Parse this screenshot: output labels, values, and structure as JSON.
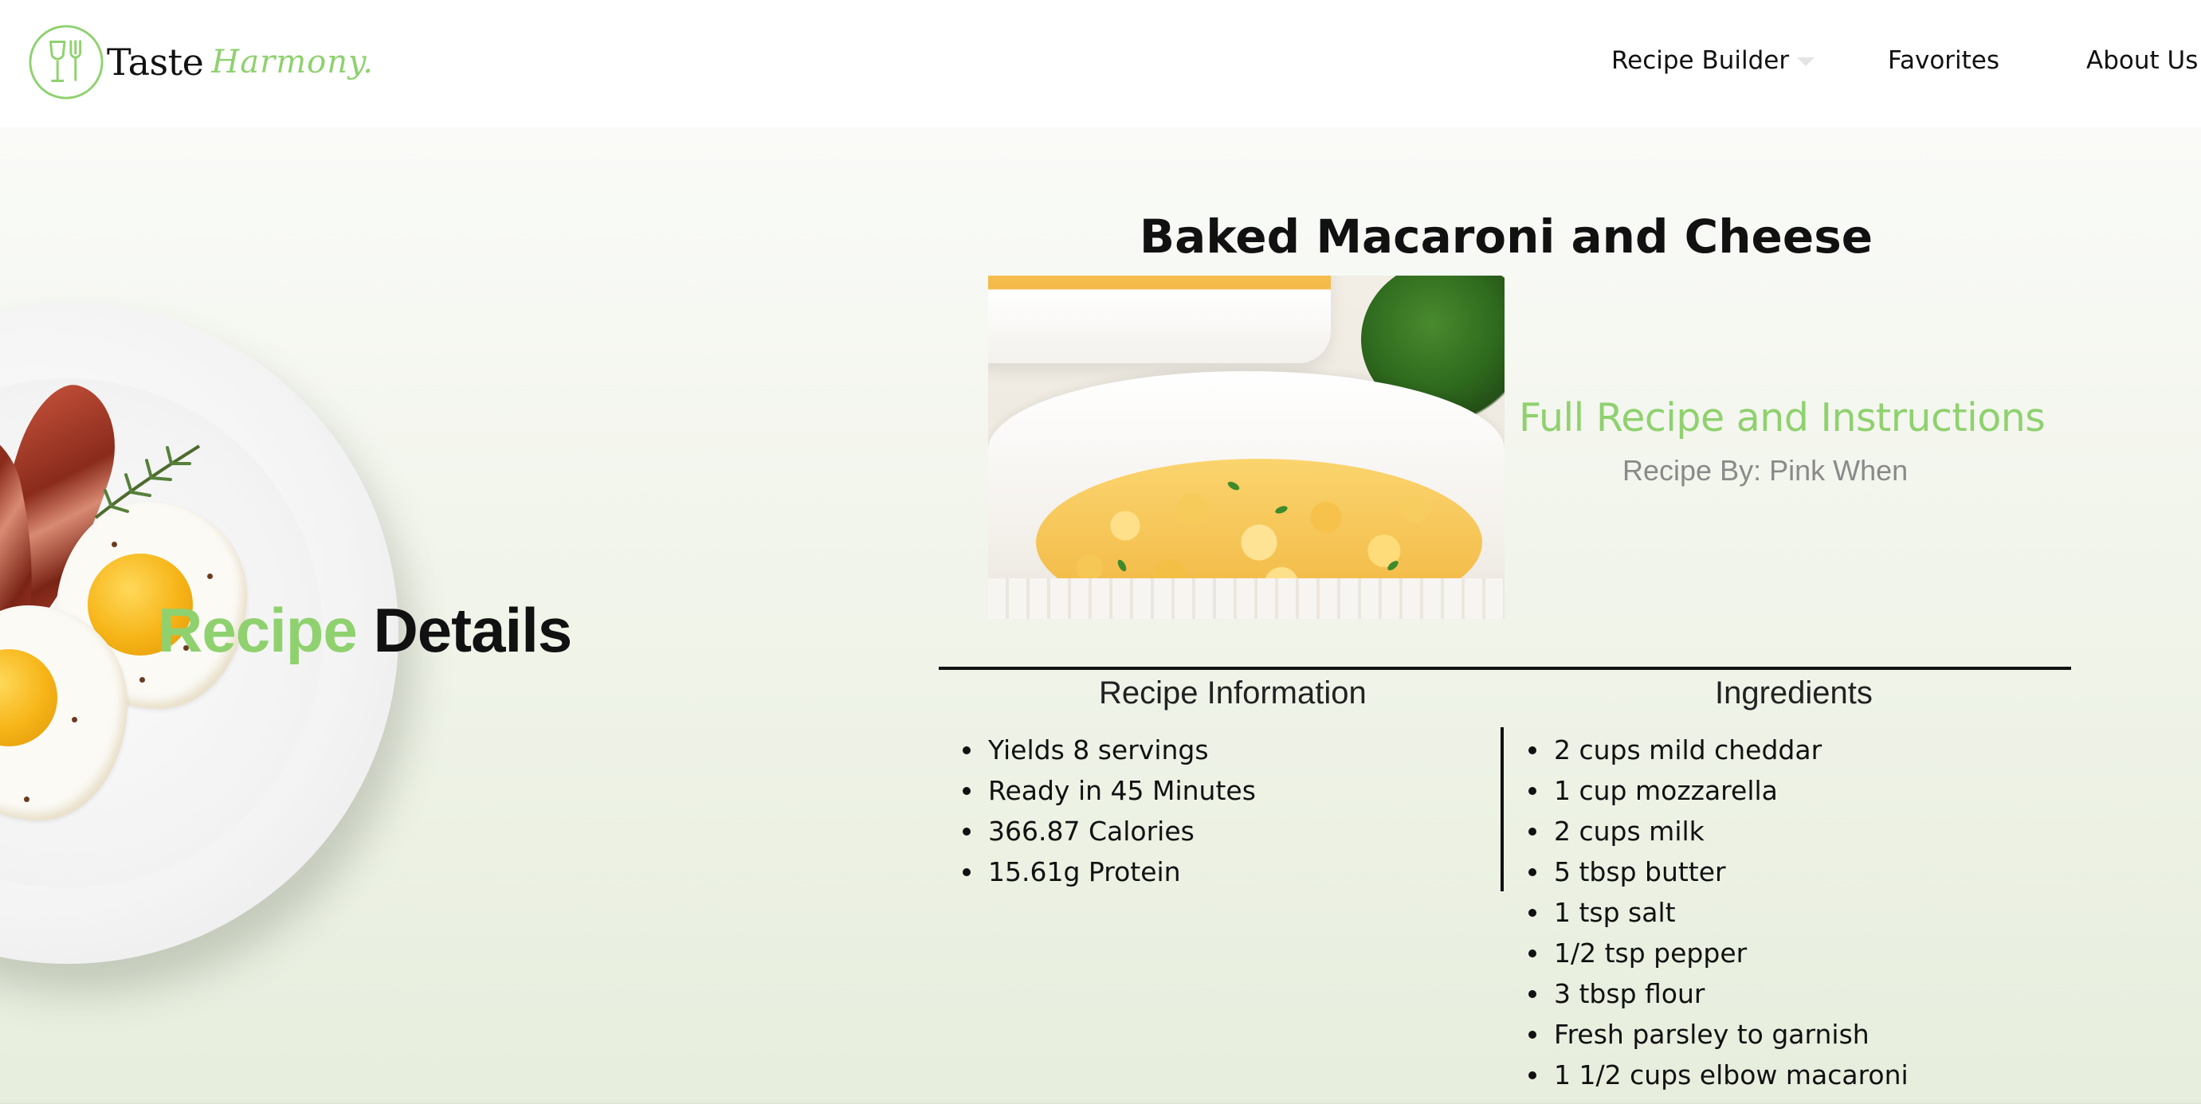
{
  "header": {
    "logo_word_1": "Taste",
    "logo_word_2": "Harmony.",
    "nav": {
      "recipe_builder": "Recipe Builder",
      "favorites": "Favorites",
      "about": "About Us"
    }
  },
  "hero": {
    "heading_accent": "Recipe",
    "heading_rest": "Details"
  },
  "recipe": {
    "title": "Baked Macaroni and Cheese",
    "link_text": "Full Recipe and Instructions",
    "author": "Recipe By: Pink When"
  },
  "table": {
    "info_heading": "Recipe Information",
    "ingredients_heading": "Ingredients",
    "info_items": [
      "Yields 8 servings",
      "Ready in 45 Minutes",
      "366.87 Calories",
      "15.61g Protein"
    ],
    "ingredients": [
      "2 cups mild cheddar",
      "1 cup mozzarella",
      "2 cups milk",
      "5 tbsp butter",
      "1 tsp salt",
      "1/2 tsp pepper",
      "3 tbsp flour",
      "Fresh parsley to garnish",
      "1 1/2 cups elbow macaroni"
    ]
  },
  "colors": {
    "accent": "#8fd16f",
    "text": "#111111",
    "muted": "#8a8a8a"
  }
}
